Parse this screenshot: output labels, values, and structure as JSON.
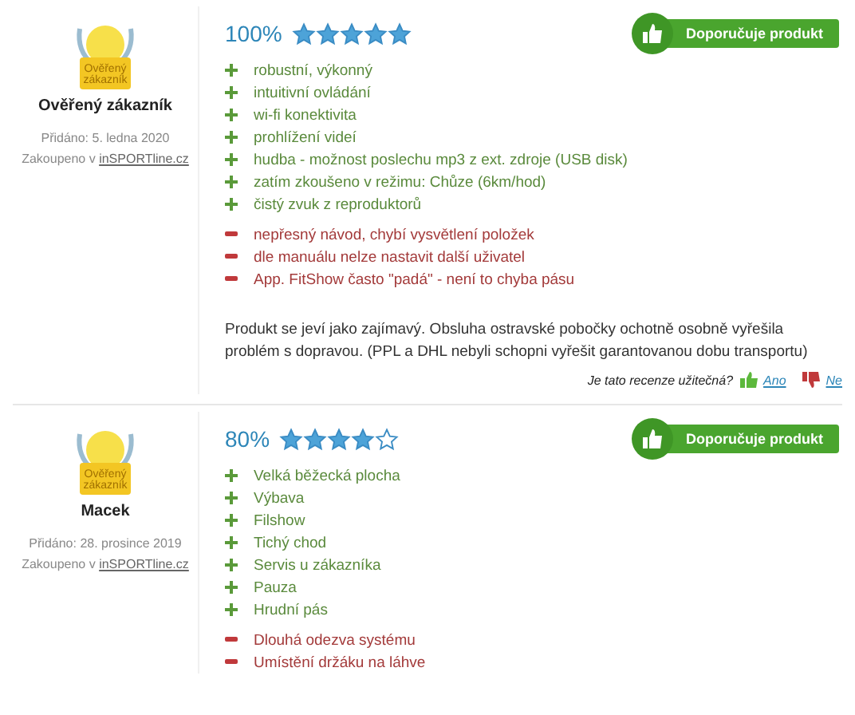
{
  "reviews": [
    {
      "author": "Ověřený zákazník",
      "badge_text": "Ověřený zákazník",
      "added": "Přidáno: 5. ledna 2020",
      "purchased_prefix": "Zakoupeno v",
      "shop_link": "inSPORTline.cz",
      "percent": "100%",
      "stars": 5,
      "recommend": "Doporučuje produkt",
      "pros": [
        "robustní, výkonný",
        "intuitivní ovládání",
        "wi-fi konektivita",
        "prohlížení videí",
        "hudba - možnost poslechu mp3 z ext. zdroje (USB disk)",
        "zatím zkoušeno v režimu: Chůze (6km/hod)",
        "čistý zvuk z reproduktorů"
      ],
      "cons": [
        "nepřesný návod, chybí vysvětlení položek",
        "dle manuálu nelze nastavit další uživatel",
        "App. FitShow často \"padá\" - není to chyba pásu"
      ],
      "text": "Produkt se jeví jako zajímavý. Obsluha ostravské pobočky ochotně osobně vyřešila problém s dopravou. (PPL a DHL nebyli schopni vyřešit garantovanou dobu transportu)",
      "helpful": {
        "question": "Je tato recenze užitečná?",
        "yes": "Ano",
        "no": "Ne"
      }
    },
    {
      "author": "Macek",
      "badge_text": "Ověřený zákazník",
      "added": "Přidáno: 28. prosince 2019",
      "purchased_prefix": "Zakoupeno v",
      "shop_link": "inSPORTline.cz",
      "percent": "80%",
      "stars": 4,
      "recommend": "Doporučuje produkt",
      "pros": [
        "Velká běžecká plocha",
        "Výbava",
        "Filshow",
        "Tichý chod",
        "Servis u zákazníka",
        "Pauza",
        "Hrudní pás"
      ],
      "cons": [
        "Dlouhá odezva systému",
        "Umístění držáku na láhve"
      ]
    }
  ]
}
